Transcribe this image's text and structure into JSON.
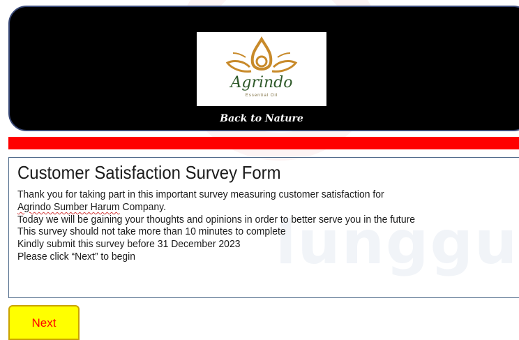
{
  "header": {
    "logo_name": "Agrindo",
    "logo_sub": "Essential Oil",
    "tagline": "Back to Nature"
  },
  "survey": {
    "title": "Customer Satisfaction Survey Form",
    "intro_line1": "Thank you for taking part in this important survey measuring customer satisfaction for",
    "company_misspelled": "Agrindo Sumber Harum",
    "company_rest": " Company.",
    "line3": "Today we will be gaining your thoughts and opinions in order to better serve you in the future",
    "line4": "This survey should not take more than 10 minutes to complete",
    "line5": "Kindly submit this survey before 31 December 2023",
    "line6": "Please click “Next” to begin"
  },
  "buttons": {
    "next_label": "Next"
  },
  "colors": {
    "header_bg": "#000000",
    "accent_bar": "#ff0000",
    "next_bg": "#ffff00",
    "next_text": "#ff0000"
  }
}
